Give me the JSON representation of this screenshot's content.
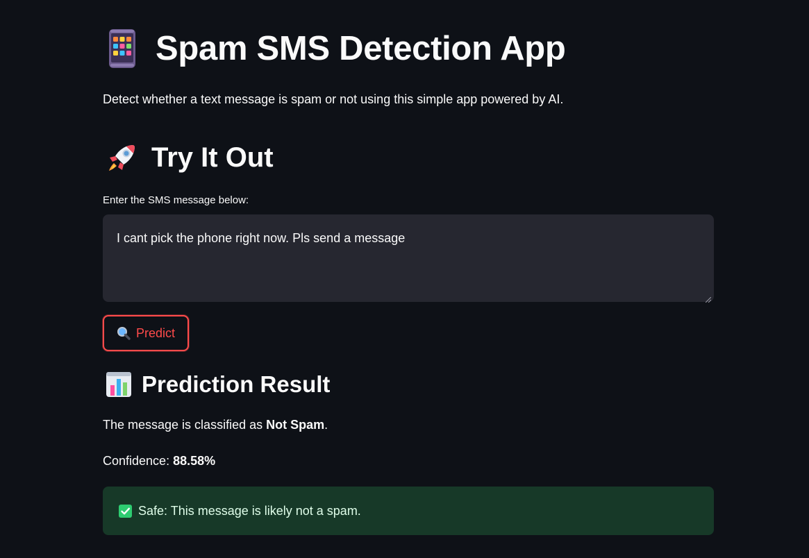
{
  "header": {
    "title": "Spam SMS Detection App",
    "title_icon": "mobile-phone-icon",
    "subtitle": "Detect whether a text message is spam or not using this simple app powered by AI."
  },
  "try_section": {
    "heading": "Try It Out",
    "heading_icon": "rocket-icon",
    "input_label": "Enter the SMS message below:",
    "input_value": "I cant pick the phone right now. Pls send a message",
    "button_label": "Predict",
    "button_icon": "magnifier-icon"
  },
  "result_section": {
    "heading": "Prediction Result",
    "heading_icon": "bar-chart-icon",
    "classified_prefix": "The message is classified as ",
    "classification": "Not Spam",
    "classified_suffix": ".",
    "confidence_prefix": "Confidence: ",
    "confidence_value": "88.58%",
    "alert_text": "Safe: This message is likely not a spam.",
    "alert_icon": "check-mark-icon"
  },
  "colors": {
    "background": "#0e1117",
    "accent": "#ff4b4b",
    "input_bg": "#262730",
    "success_bg": "#173928"
  }
}
